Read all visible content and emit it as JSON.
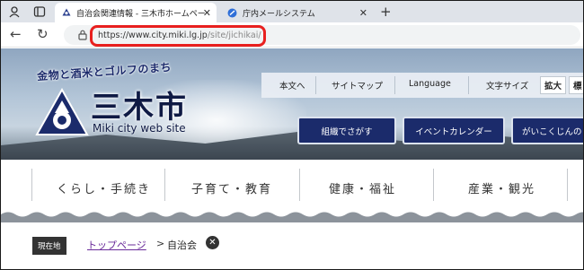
{
  "browser": {
    "tabs": [
      {
        "title": "自治会関連情報 - 三木市ホームペー",
        "icon": "site-favicon",
        "active": true
      },
      {
        "title": "庁内メールシステム",
        "icon": "app-favicon",
        "active": false
      }
    ],
    "close_glyph": "✕",
    "newtab_glyph": "+",
    "back_glyph": "←",
    "reload_glyph": "↻",
    "url_host": "https://www.city.miki.lg.jp",
    "url_path": "/site/jichikai/"
  },
  "site": {
    "slogan": "金物と酒米とゴルフのまち",
    "city_name": "三木市",
    "city_web": "Miki city web site",
    "utility": {
      "skip": "本文へ",
      "sitemap": "サイトマップ",
      "language": "Language",
      "font_size_label": "文字サイズ",
      "enlarge": "拡大",
      "standard": "標"
    },
    "buttons": {
      "find_org": "組織でさがす",
      "events": "イベントカレンダー",
      "gaikoku": "がいこくじんの"
    },
    "nav": [
      "くらし・手続き",
      "子育て・教育",
      "健康・福祉",
      "産業・観光"
    ],
    "breadcrumb": {
      "here_label": "現在地",
      "home": "トップページ",
      "sep": ">",
      "current": "自治会",
      "clear_glyph": "✕"
    }
  },
  "colors": {
    "highlight": "#e8201f",
    "brand": "#1b2b6b"
  }
}
